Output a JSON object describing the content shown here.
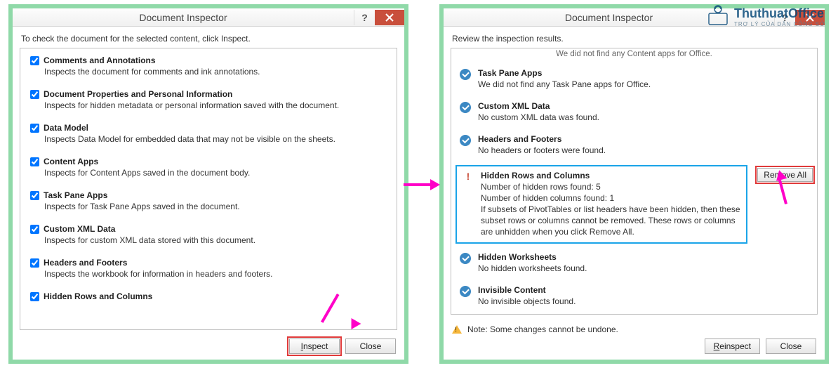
{
  "left": {
    "title": "Document Inspector",
    "instruct": "To check the document for the selected content, click Inspect.",
    "items": [
      {
        "label": "Comments and Annotations",
        "desc": "Inspects the document for comments and ink annotations."
      },
      {
        "label": "Document Properties and Personal Information",
        "desc": "Inspects for hidden metadata or personal information saved with the document."
      },
      {
        "label": "Data Model",
        "desc": "Inspects Data Model for embedded data that may not be visible on the sheets."
      },
      {
        "label": "Content Apps",
        "desc": "Inspects for Content Apps saved in the document body."
      },
      {
        "label": "Task Pane Apps",
        "desc": "Inspects for Task Pane Apps saved in the document."
      },
      {
        "label": "Custom XML Data",
        "desc": "Inspects for custom XML data stored with this document."
      },
      {
        "label": "Headers and Footers",
        "desc": "Inspects the workbook for information in headers and footers."
      },
      {
        "label": "Hidden Rows and Columns",
        "desc": ""
      }
    ],
    "inspect_btn": "Inspect",
    "close_btn": "Close"
  },
  "right": {
    "title": "Document Inspector",
    "instruct": "Review the inspection results.",
    "top_cut": "We did not find any Content apps for Office.",
    "results": [
      {
        "status": "ok",
        "label": "Task Pane Apps",
        "desc": "We did not find any Task Pane apps for Office."
      },
      {
        "status": "ok",
        "label": "Custom XML Data",
        "desc": "No custom XML data was found."
      },
      {
        "status": "ok",
        "label": "Headers and Footers",
        "desc": "No headers or footers were found."
      }
    ],
    "hidden_rows": {
      "label": "Hidden Rows and Columns",
      "lines": [
        "Number of hidden rows found: 5",
        "Number of hidden columns found: 1",
        "If subsets of PivotTables or list headers have been hidden, then these subset rows or columns cannot be removed. These rows or columns are unhidden when you click Remove All."
      ],
      "remove_btn": "Remove All"
    },
    "after": [
      {
        "status": "ok",
        "label": "Hidden Worksheets",
        "desc": "No hidden worksheets found."
      },
      {
        "status": "ok",
        "label": "Invisible Content",
        "desc": "No invisible objects found."
      }
    ],
    "note": "Note: Some changes cannot be undone.",
    "reinspect_btn": "Reinspect",
    "close_btn": "Close"
  },
  "logo": {
    "name": "ThuthuatOffice",
    "tag": "TRỢ LÝ CỦA DÂN CÔNG SỞ"
  }
}
